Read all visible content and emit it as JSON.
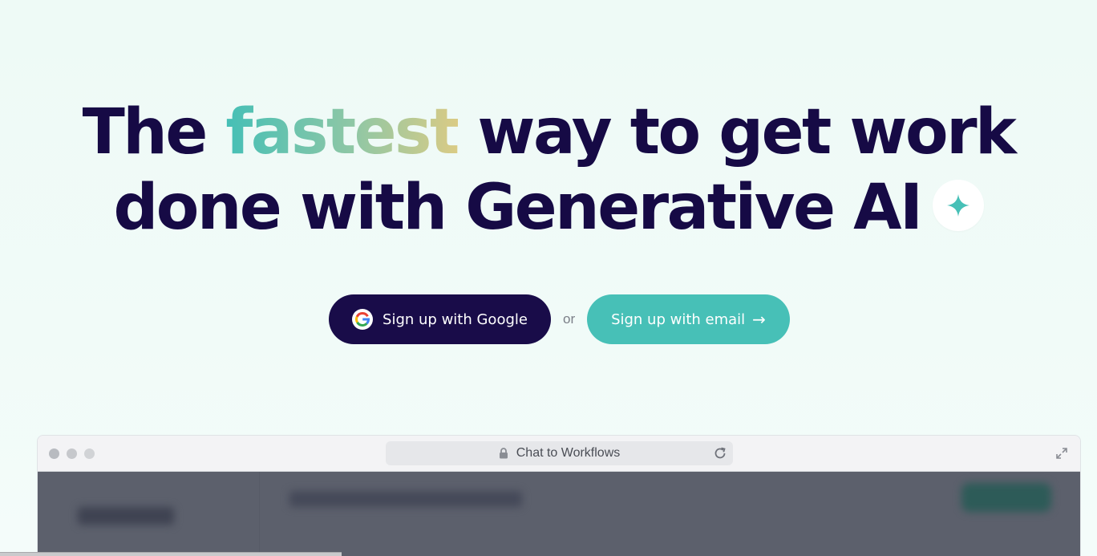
{
  "hero": {
    "headline_part1": "The ",
    "headline_highlight": "fastest",
    "headline_part2": " way to get work",
    "headline_line2": "done with Generative AI",
    "badge_icon": "sparkle-icon"
  },
  "cta": {
    "google_label": "Sign up with Google",
    "google_icon": "google-logo-icon",
    "or_label": "or",
    "email_label": "Sign up with email",
    "email_arrow": "→"
  },
  "browser": {
    "address_text": "Chat to Workflows",
    "lock_icon": "lock-icon",
    "reload_icon": "reload-icon",
    "expand_icon": "expand-icon"
  },
  "colors": {
    "navy": "#190c49",
    "teal": "#47c0b7",
    "gradient_start": "#45bfb6",
    "gradient_end": "#dacb85",
    "background": "#eefaf6"
  }
}
